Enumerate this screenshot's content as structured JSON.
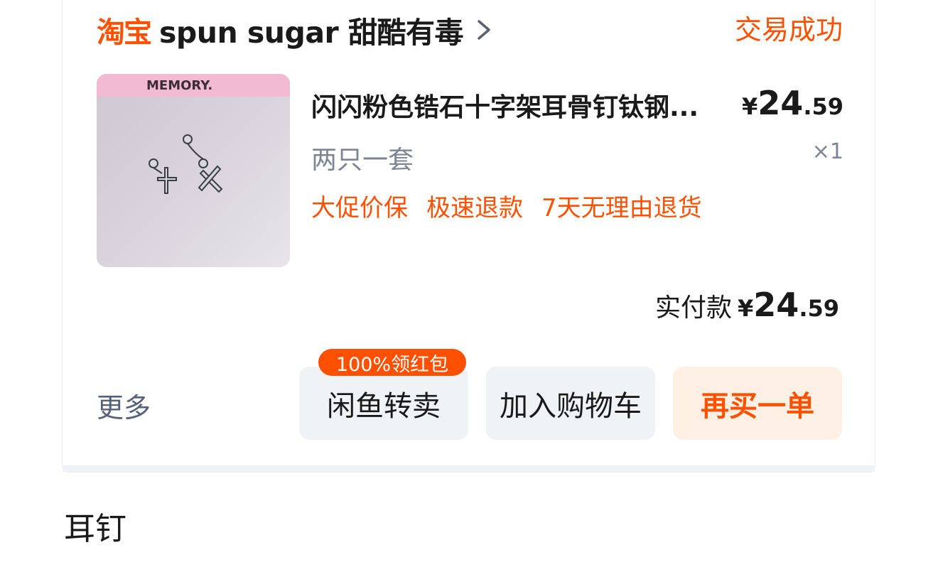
{
  "order": {
    "platform_logo": "淘宝",
    "shop_name": "spun sugar 甜酷有毒",
    "status": "交易成功",
    "item": {
      "title": "闪闪粉色锆石十字架耳骨钉钛钢...",
      "price_symbol": "¥",
      "price_int": "24",
      "price_dec": ".59",
      "spec": "两只一套",
      "quantity": "×1",
      "image_text": "MEMORY.",
      "tags": [
        "大促价保",
        "极速退款",
        "7天无理由退货"
      ]
    },
    "payment": {
      "label": "实付款",
      "symbol": "¥",
      "int": "24",
      "dec": ".59"
    },
    "actions": {
      "more": "更多",
      "resell": "闲鱼转卖",
      "resell_badge": "100%领红包",
      "add_to_cart": "加入购物车",
      "rebuy": "再买一单"
    }
  },
  "note": "耳钉",
  "colors": {
    "accent": "#ff5000",
    "muted_text": "#7c8595",
    "button_bg": "#eff3f6",
    "rebuy_bg": "#fff0e6"
  }
}
